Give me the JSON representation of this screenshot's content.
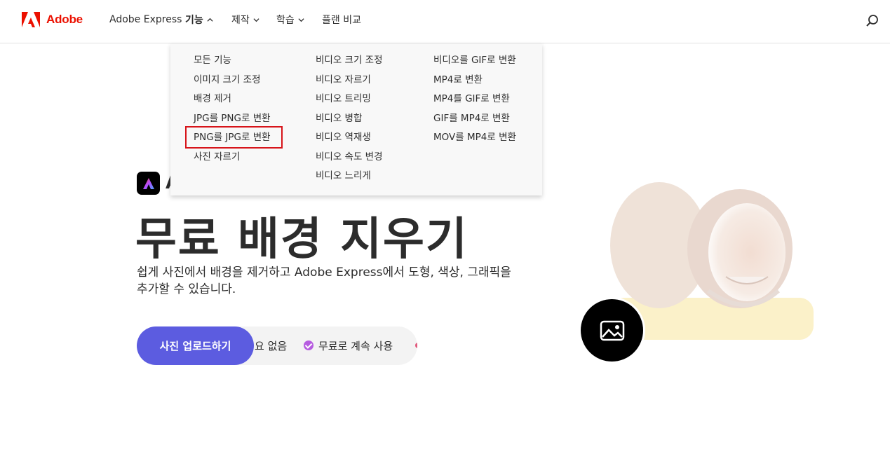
{
  "brand": {
    "name": "Adobe",
    "color": "#eb1000"
  },
  "nav": {
    "items": [
      {
        "label": "Adobe Express",
        "has_chevron": false
      },
      {
        "label": "기능",
        "has_chevron": true,
        "expanded": true
      },
      {
        "label": "제작",
        "has_chevron": true
      },
      {
        "label": "학습",
        "has_chevron": true
      },
      {
        "label": "플랜 비교",
        "has_chevron": false
      }
    ],
    "search_icon": "search-icon"
  },
  "dropdown": {
    "columns": [
      [
        "모든 기능",
        "이미지 크기 조정",
        "배경 제거",
        "JPG를 PNG로 변환",
        "PNG를 JPG로 변환",
        "사진 자르기"
      ],
      [
        "비디오 크기 조정",
        "비디오 자르기",
        "비디오 트리밍",
        "비디오 병합",
        "비디오 역재생",
        "비디오 속도 변경",
        "비디오 느리게"
      ],
      [
        "비디오를 GIF로 변환",
        "MP4로 변환",
        "MP4를 GIF로 변환",
        "GIF를 MP4로 변환",
        "MOV를 MP4로 변환"
      ]
    ],
    "highlighted_item": "PNG를 JPG로 변환",
    "highlight_color": "#d7141a"
  },
  "hero": {
    "app_initial": "A",
    "title": "무료 배경 지우기",
    "description": "쉽게 사진에서 배경을 제거하고 Adobe Express에서 도형, 색상, 그래픽을 추가할 수 있습니다.",
    "upload_button": "사진 업로드하기",
    "features": [
      "요 없음",
      "무료로 계속 사용"
    ],
    "button_color": "#5c5ce0",
    "check_color": "#b65ce0"
  },
  "image_button_icon": "image-icon"
}
